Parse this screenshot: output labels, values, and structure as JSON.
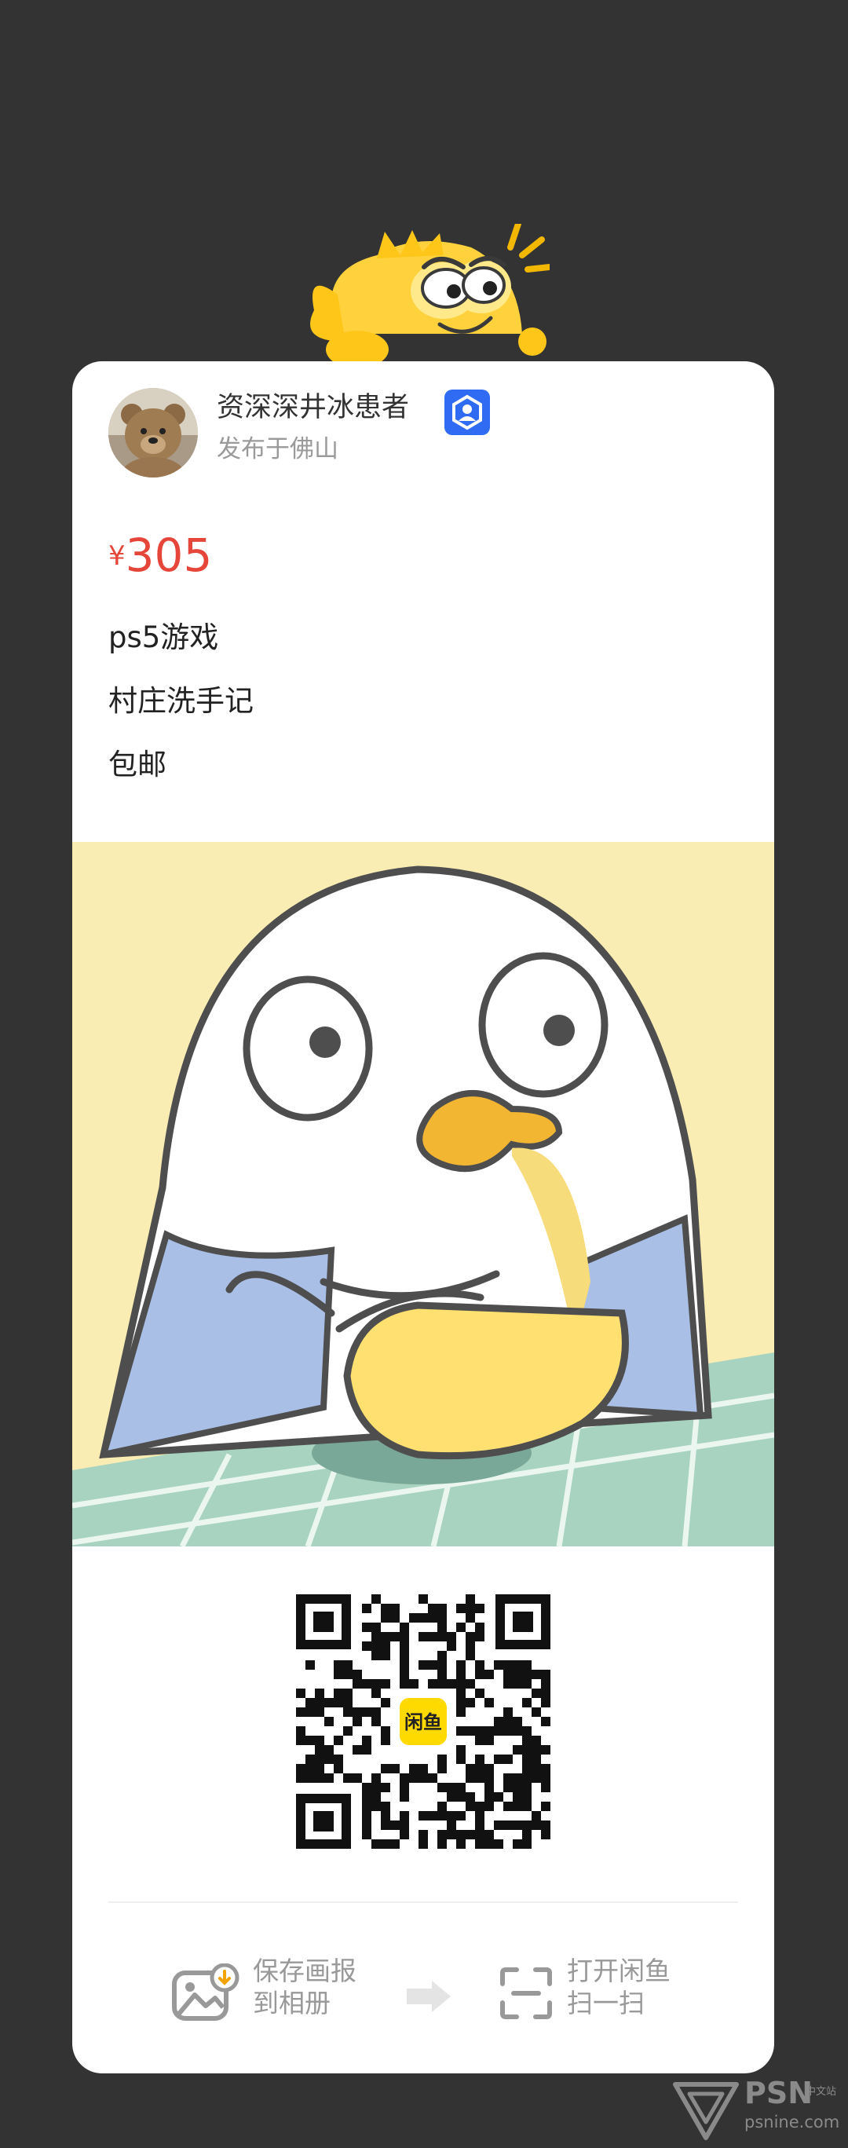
{
  "seller": {
    "name": "资深深井冰患者",
    "location": "发布于佛山"
  },
  "item": {
    "currency": "¥",
    "price": "305",
    "description": [
      "ps5游戏",
      "村庄洗手记",
      "包邮"
    ]
  },
  "qr": {
    "logo_text": "闲鱼"
  },
  "actions": {
    "save": {
      "line1": "保存画报",
      "line2": "到相册"
    },
    "open": {
      "line1": "打开闲鱼",
      "line2": "扫一扫"
    }
  },
  "watermark": {
    "brand": "PSN",
    "cn": "中文站",
    "url": "psnine.com"
  },
  "colors": {
    "background": "#333333",
    "card": "#ffffff",
    "price": "#e6463a",
    "badge": "#2f6cf3",
    "illustration_bg": "#faedb4",
    "qr_logo": "#ffda00"
  },
  "icons": [
    "fish-mascot",
    "verified-badge-icon",
    "save-image-icon",
    "arrow-right-icon",
    "scan-icon",
    "psn-logo-icon"
  ]
}
